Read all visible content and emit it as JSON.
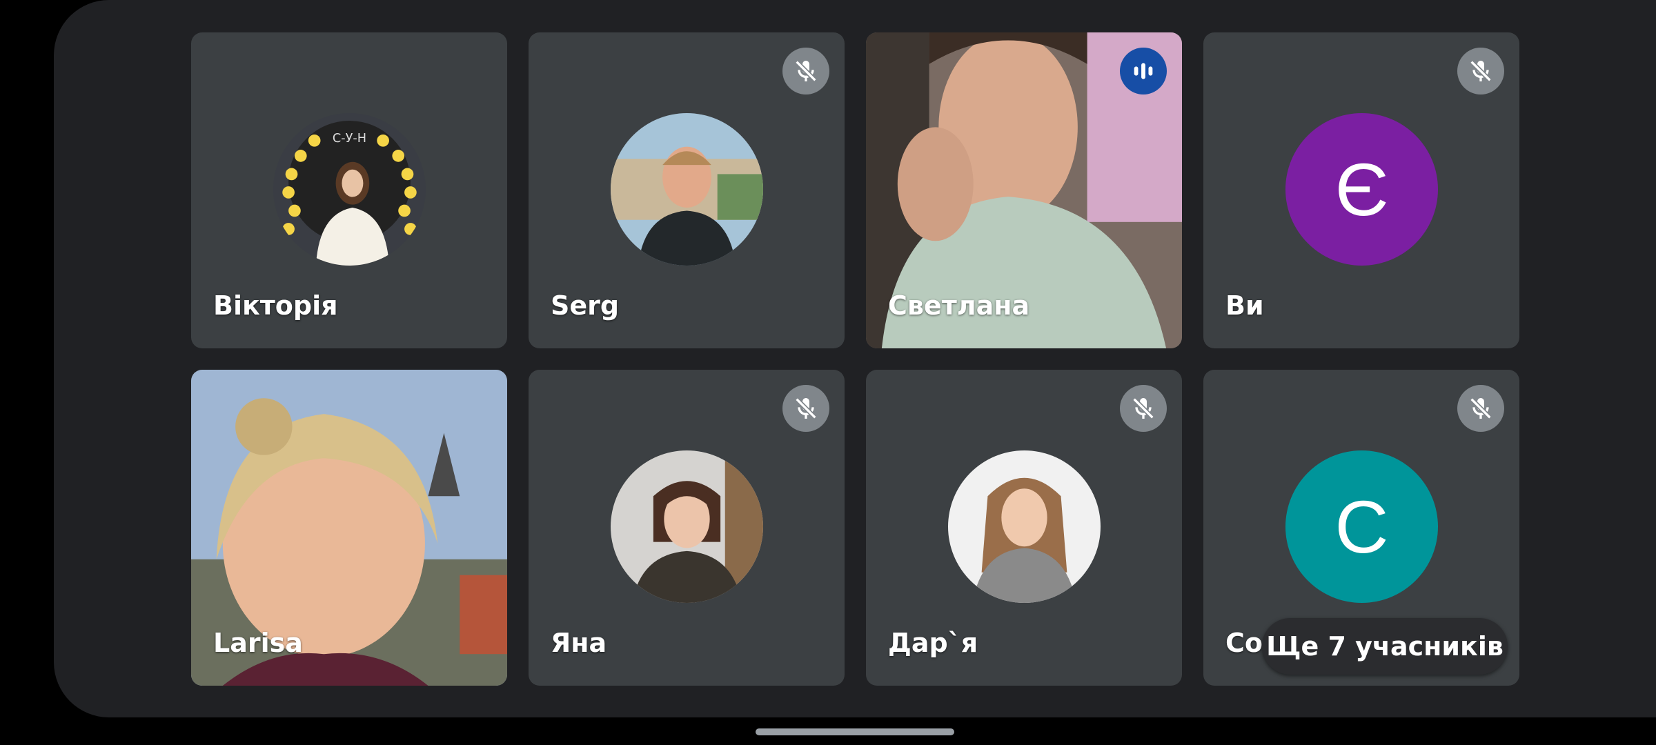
{
  "participants": [
    {
      "name": "Вікторія",
      "muted": false,
      "type": "avatar-photo"
    },
    {
      "name": "Serg",
      "muted": true,
      "type": "avatar-photo"
    },
    {
      "name": "Светлана",
      "muted": false,
      "speaking": true,
      "type": "video"
    },
    {
      "name": "Ви",
      "muted": true,
      "type": "initial",
      "initial": "Є",
      "color": "#7b1fa2"
    },
    {
      "name": "Larisa",
      "muted": false,
      "type": "video"
    },
    {
      "name": "Яна",
      "muted": true,
      "type": "avatar-photo"
    },
    {
      "name": "Дар`я",
      "muted": true,
      "type": "avatar-photo"
    },
    {
      "name": "Соня",
      "muted": true,
      "type": "initial",
      "initial": "С",
      "color": "#00959a"
    }
  ],
  "more_participants_label": "Ще 7 учасників",
  "colors": {
    "background": "#202124",
    "tile": "#3c4043",
    "mic_badge": "#80868b",
    "speaking_badge": "#174ea6"
  }
}
